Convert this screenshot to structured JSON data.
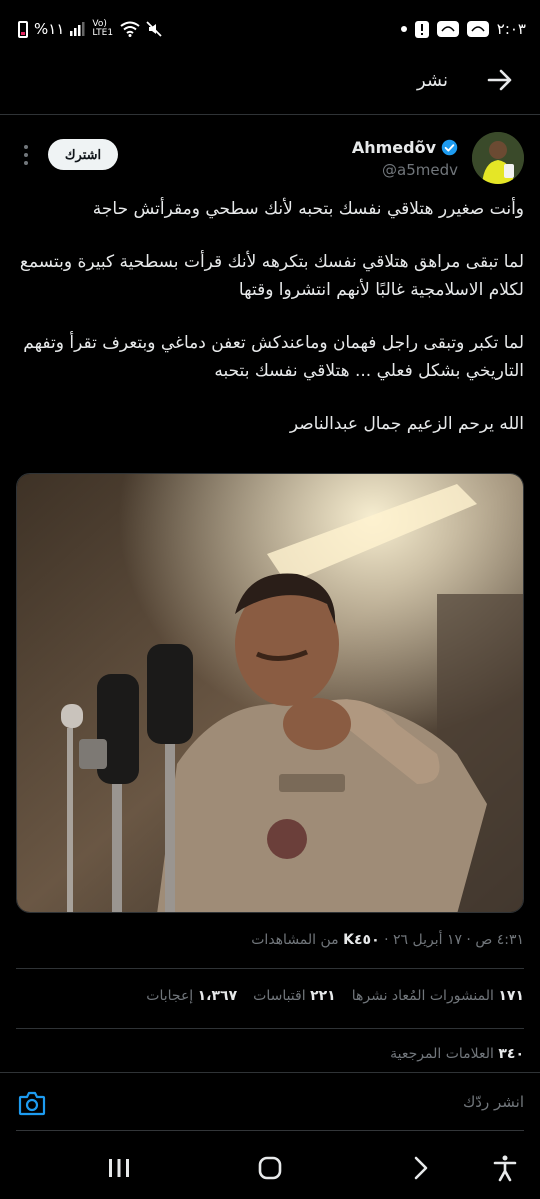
{
  "status_bar": {
    "time": "٢:٠٣",
    "battery": "%١١",
    "network": "Vo) LTE1"
  },
  "header": {
    "title": "نشر",
    "back_icon": "arrow-icon"
  },
  "tweet": {
    "author_name": "Ahmedõv",
    "author_handle": "@a5medv",
    "subscribe_label": "اشترك",
    "paragraphs": [
      "وأنت صغيرر هتلاقي نفسك بتحبه لأنك سطحي ومقرأتش حاجة",
      "لما تبقى مراهق هتلاقي نفسك بتكرهه لأنك قرأت بسطحية كبيرة وبتسمع لكلام الاسلامجية غالبًا لأنهم انتشروا وقتها",
      "لما تكبر وتبقى راجل فهمان وماعندكش تعفن دماغي وبتعرف تقرأ وتفهم التاريخي بشكل فعلي ... هتلاقي نفسك بتحبه",
      "الله يرحم الزعيم جمال عبدالناصر"
    ],
    "timestamp": "٤:٣١ ص · ١٧ أبريل ٢٦ ·",
    "views_count": "K٤٥٠",
    "views_label": "من المشاهدات"
  },
  "stats": {
    "reposts_count": "١٧١",
    "reposts_label": "المنشورات المُعاد نشرها",
    "quotes_count": "٢٢١",
    "quotes_label": "اقتباسات",
    "likes_count": "١،٣٦٧",
    "likes_label": "إعجابات",
    "bookmarks_count": "٣٤٠",
    "bookmarks_label": "العلامات المرجعية"
  },
  "reply": {
    "placeholder": "انشر ردّك"
  },
  "colors": {
    "background": "#000000",
    "accent": "#1d9bf0",
    "text": "#e7e9ea",
    "muted": "#71767b"
  }
}
